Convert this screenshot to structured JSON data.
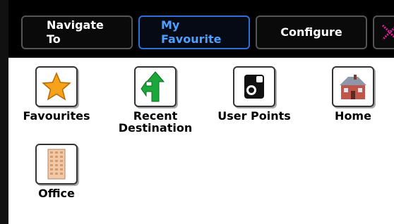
{
  "tabs": {
    "navigate_to": "Navigate\nTo",
    "my_favourite": "My\nFavourite",
    "configure": "Configure"
  },
  "close_icon": "close-icon",
  "items": [
    {
      "label": "Favourites",
      "icon": "star-icon"
    },
    {
      "label": "Recent\nDestination",
      "icon": "direction-arrow-icon"
    },
    {
      "label": "User Points",
      "icon": "speed-camera-icon"
    },
    {
      "label": "Home",
      "icon": "house-icon"
    },
    {
      "label": "Office",
      "icon": "office-building-icon"
    }
  ],
  "colors": {
    "active_tab_text": "#4da0ff",
    "active_tab_border": "#2f6fd6",
    "close_icon": "#e0209a",
    "star": "#f6a21a",
    "arrow": "#1aa83b"
  }
}
